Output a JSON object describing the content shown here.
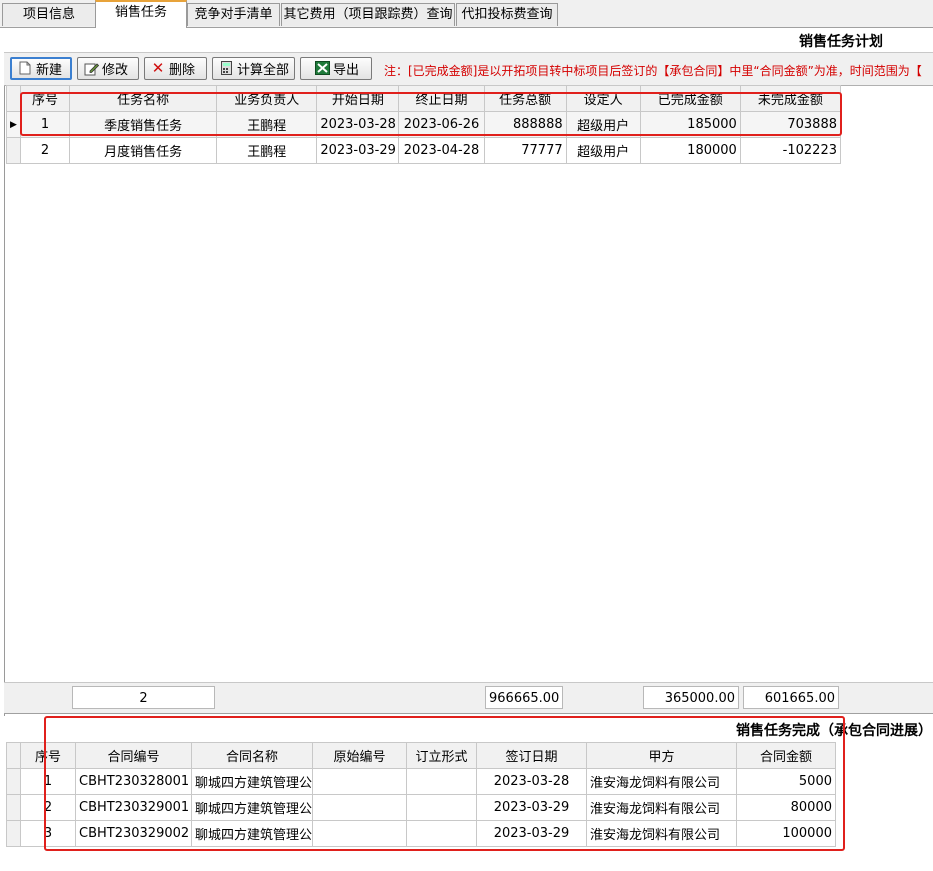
{
  "tabs": [
    "项目信息",
    "销售任务",
    "竞争对手清单",
    "其它费用（项目跟踪费）查询",
    "代扣投标费查询"
  ],
  "panel_title": "销售任务计划",
  "toolbar": {
    "new_label": "新建",
    "edit_label": "修改",
    "delete_label": "删除",
    "calc_label": "计算全部",
    "export_label": "导出",
    "note": "注：[已完成金额]是以开拓项目转中标项目后签订的【承包合同】中里“合同金额”为准，时间范围为【"
  },
  "task_table": {
    "columns": [
      "序号",
      "任务名称",
      "业务负责人",
      "开始日期",
      "终止日期",
      "任务总额",
      "设定人",
      "已完成金额",
      "未完成金额"
    ],
    "rows": [
      [
        "1",
        "季度销售任务",
        "王鹏程",
        "2023-03-28",
        "2023-06-26",
        "888888",
        "超级用户",
        "185000",
        "703888"
      ],
      [
        "2",
        "月度销售任务",
        "王鹏程",
        "2023-03-29",
        "2023-04-28",
        "77777",
        "超级用户",
        "180000",
        "-102223"
      ]
    ]
  },
  "footer": {
    "count": "2",
    "total": "966665.00",
    "completed": "365000.00",
    "remaining": "601665.00"
  },
  "completion_title": "销售任务完成（承包合同进展）",
  "contract_table": {
    "columns": [
      "序号",
      "合同编号",
      "合同名称",
      "原始编号",
      "订立形式",
      "签订日期",
      "甲方",
      "合同金额"
    ],
    "rows": [
      [
        "1",
        "CBHT230328001",
        "聊城四方建筑管理公",
        "",
        "",
        "2023-03-28",
        "淮安海龙饲料有限公司",
        "5000"
      ],
      [
        "2",
        "CBHT230329001",
        "聊城四方建筑管理公",
        "",
        "",
        "2023-03-29",
        "淮安海龙饲料有限公司",
        "80000"
      ],
      [
        "3",
        "CBHT230329002",
        "聊城四方建筑管理公",
        "",
        "",
        "2023-03-29",
        "淮安海龙饲料有限公司",
        "100000"
      ]
    ]
  },
  "colors": {
    "highlight": "#e0201c",
    "note": "#d40000",
    "active_tab": "#e8a33a"
  }
}
